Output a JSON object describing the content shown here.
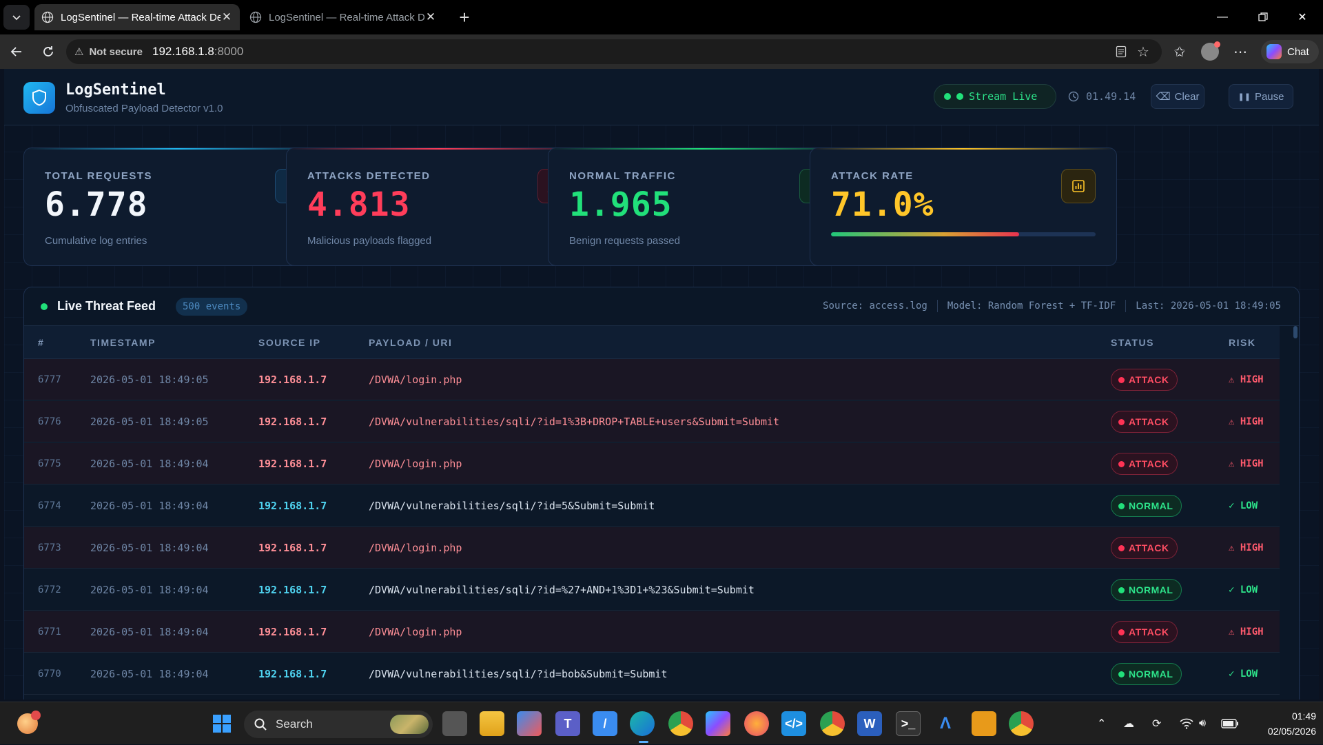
{
  "browser": {
    "tabs": [
      {
        "title": "LogSentinel — Real-time Attack De",
        "active": true
      },
      {
        "title": "LogSentinel — Real-time Attack De",
        "active": false
      }
    ],
    "address": {
      "security_label": "Not secure",
      "host": "192.168.1.8",
      "port": ":8000"
    },
    "chat_label": "Chat"
  },
  "app": {
    "title": "LogSentinel",
    "subtitle": "Obfuscated Payload Detector v1.0",
    "stream_label": "Stream Live",
    "clock": "01.49.14",
    "clear_label": "Clear",
    "pause_label": "Pause"
  },
  "cards": [
    {
      "label": "TOTAL REQUESTS",
      "value": "6.778",
      "sub": "Cumulative log entries",
      "color": "#f2f6fb",
      "accent": "#21b8f0",
      "icon": "bar-chart-icon"
    },
    {
      "label": "ATTACKS DETECTED",
      "value": "4.813",
      "sub": "Malicious payloads flagged",
      "color": "#ff3d5a",
      "accent": "#ff3d5a",
      "icon": "alert-triangle-icon"
    },
    {
      "label": "NORMAL TRAFFIC",
      "value": "1.965",
      "sub": "Benign requests passed",
      "color": "#21e07a",
      "accent": "#21e07a",
      "icon": "shield-check-icon"
    },
    {
      "label": "ATTACK RATE",
      "value": "71.0%",
      "rate_fraction": 0.71,
      "color": "#ffc629",
      "accent": "#ffc629",
      "icon": "report-icon"
    }
  ],
  "feed": {
    "title": "Live Threat Feed",
    "events_badge": "500 events",
    "source": "Source: access.log",
    "model": "Model: Random Forest + TF-IDF",
    "last": "Last: 2026-05-01 18:49:05",
    "columns": [
      "#",
      "TIMESTAMP",
      "SOURCE IP",
      "PAYLOAD / URI",
      "STATUS",
      "RISK"
    ],
    "rows": [
      {
        "num": "6777",
        "ts": "2026-05-01 18:49:05",
        "ip": "192.168.1.7",
        "payload": "/DVWA/login.php",
        "status": "ATTACK",
        "risk": "⚠ HIGH",
        "kind": "attack"
      },
      {
        "num": "6776",
        "ts": "2026-05-01 18:49:05",
        "ip": "192.168.1.7",
        "payload": "/DVWA/vulnerabilities/sqli/?id=1%3B+DROP+TABLE+users&Submit=Submit",
        "status": "ATTACK",
        "risk": "⚠ HIGH",
        "kind": "attack"
      },
      {
        "num": "6775",
        "ts": "2026-05-01 18:49:04",
        "ip": "192.168.1.7",
        "payload": "/DVWA/login.php",
        "status": "ATTACK",
        "risk": "⚠ HIGH",
        "kind": "attack"
      },
      {
        "num": "6774",
        "ts": "2026-05-01 18:49:04",
        "ip": "192.168.1.7",
        "payload": "/DVWA/vulnerabilities/sqli/?id=5&Submit=Submit",
        "status": "NORMAL",
        "risk": "✓ LOW",
        "kind": "normal"
      },
      {
        "num": "6773",
        "ts": "2026-05-01 18:49:04",
        "ip": "192.168.1.7",
        "payload": "/DVWA/login.php",
        "status": "ATTACK",
        "risk": "⚠ HIGH",
        "kind": "attack"
      },
      {
        "num": "6772",
        "ts": "2026-05-01 18:49:04",
        "ip": "192.168.1.7",
        "payload": "/DVWA/vulnerabilities/sqli/?id=%27+AND+1%3D1+%23&Submit=Submit",
        "status": "NORMAL",
        "risk": "✓ LOW",
        "kind": "normal"
      },
      {
        "num": "6771",
        "ts": "2026-05-01 18:49:04",
        "ip": "192.168.1.7",
        "payload": "/DVWA/login.php",
        "status": "ATTACK",
        "risk": "⚠ HIGH",
        "kind": "attack"
      },
      {
        "num": "6770",
        "ts": "2026-05-01 18:49:04",
        "ip": "192.168.1.7",
        "payload": "/DVWA/vulnerabilities/sqli/?id=bob&Submit=Submit",
        "status": "NORMAL",
        "risk": "✓ LOW",
        "kind": "normal"
      }
    ]
  },
  "taskbar": {
    "search_label": "Search",
    "time": "01:49",
    "date": "02/05/2026",
    "apps": [
      "start-icon",
      "task-view-icon",
      "file-explorer-icon",
      "store-icon",
      "teams-icon",
      "app-icon",
      "edge-icon",
      "chrome-icon",
      "copilot-icon",
      "firefox-icon",
      "vscode-icon",
      "chrome-profile-icon",
      "word-icon",
      "terminal-icon",
      "arch-icon",
      "remote-desktop-icon",
      "chrome-badge-icon"
    ]
  }
}
